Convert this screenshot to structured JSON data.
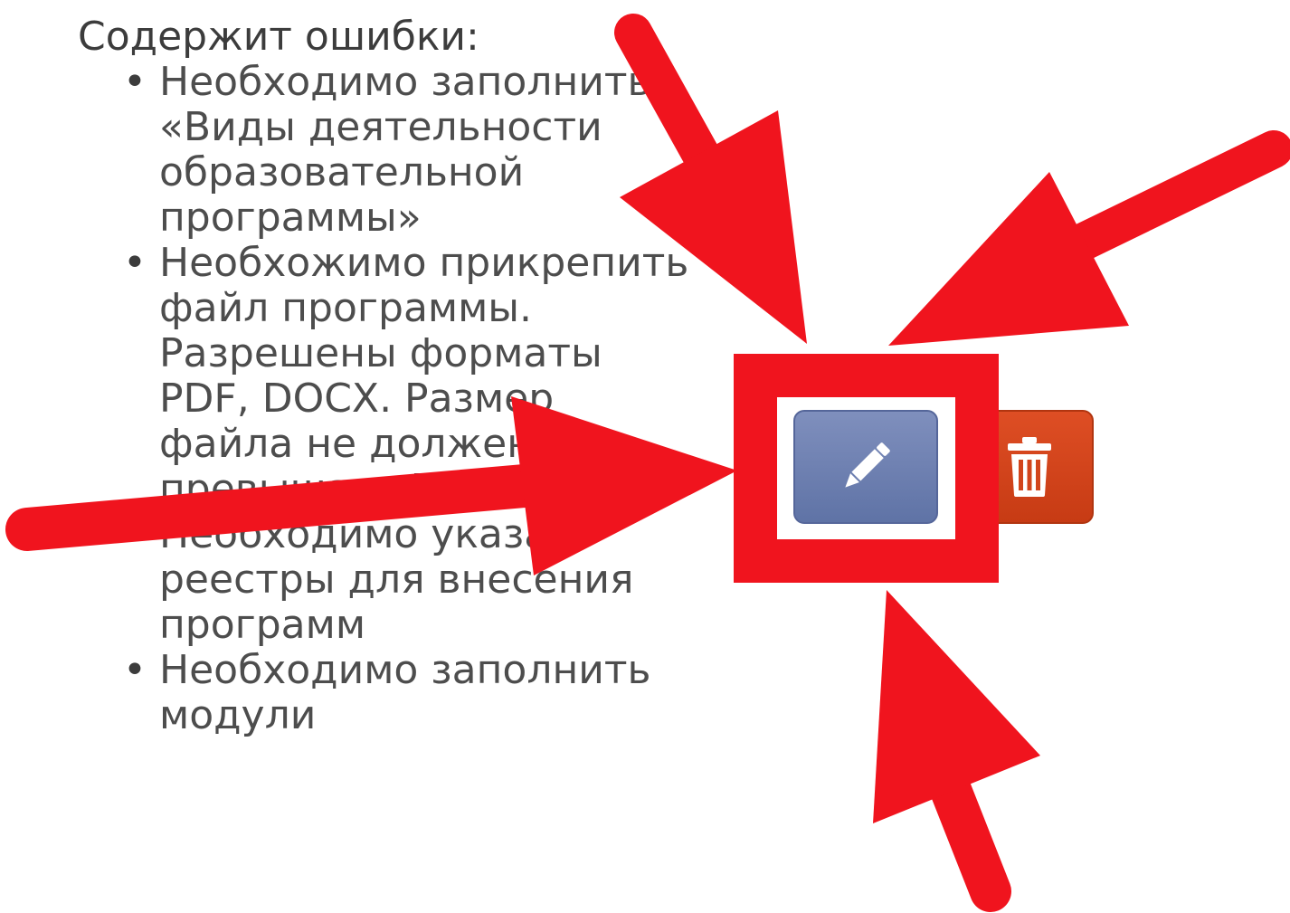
{
  "errors": {
    "title": "Содержит ошибки:",
    "items": [
      "Необходимо заполнить «Виды деятельности образовательной программы»",
      "Необхожимо прикрепить файл программы. Разрешены форматы PDF, DOCX. Размер файла не должен превышать 5 Mb",
      "Необходимо указать реестры для внесения программ",
      "Необходимо заполнить модули"
    ]
  },
  "actions": {
    "edit_icon": "pencil-icon",
    "delete_icon": "trash-icon",
    "edit_color": "#6b7db0",
    "delete_color": "#d2441b"
  },
  "annotation": {
    "color": "#f0141e",
    "highlight_target": "edit-button",
    "arrow_count": 4
  }
}
